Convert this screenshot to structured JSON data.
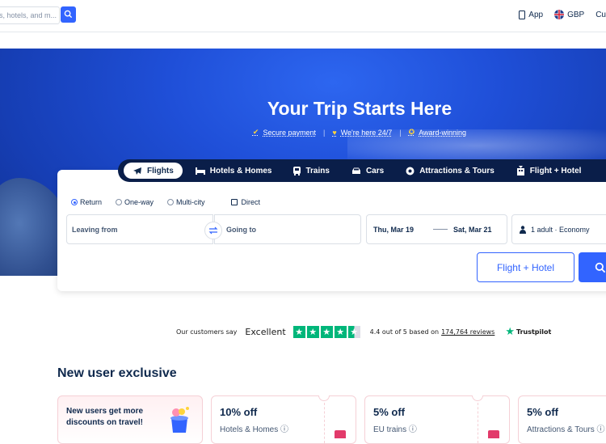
{
  "topbar": {
    "search_placeholder": "s, hotels, and m...",
    "app_label": "App",
    "currency_label": "GBP",
    "more_label": "Cu"
  },
  "hero": {
    "title": "Your Trip Starts Here",
    "perks": [
      "Secure payment",
      "We're here 24/7",
      "Award-winning"
    ]
  },
  "tabs": [
    {
      "label": "Flights",
      "icon": "plane-icon",
      "active": true
    },
    {
      "label": "Hotels & Homes",
      "icon": "bed-icon"
    },
    {
      "label": "Trains",
      "icon": "train-icon"
    },
    {
      "label": "Cars",
      "icon": "car-icon"
    },
    {
      "label": "Attractions & Tours",
      "icon": "attraction-icon"
    },
    {
      "label": "Flight + Hotel",
      "icon": "flight-hotel-icon"
    }
  ],
  "search_form": {
    "trip_types": [
      "Return",
      "One-way",
      "Multi-city"
    ],
    "selected_trip_type": "Return",
    "direct_label": "Direct",
    "leaving_placeholder": "Leaving from",
    "going_placeholder": "Going to",
    "depart_date": "Thu, Mar 19",
    "return_date": "Sat, Mar 21",
    "passengers": "1 adult · Economy",
    "flight_hotel_button": "Flight + Hotel"
  },
  "trustpilot": {
    "prefix": "Our customers say",
    "rating_word": "Excellent",
    "score_text": "4.4 out of 5 based on",
    "reviews_link": "174,764 reviews",
    "brand": "Trustpilot",
    "stars": 4.5
  },
  "promos": {
    "title": "New user exclusive",
    "cards": [
      {
        "heading": "New users get more discounts on travel!"
      },
      {
        "heading": "10% off",
        "sub": "Hotels & Homes ⓘ"
      },
      {
        "heading": "5% off",
        "sub": "EU trains ⓘ"
      },
      {
        "heading": "5% off",
        "sub": "Attractions & Tours ⓘ"
      }
    ]
  },
  "colors": {
    "accent": "#3264ff",
    "tab_bar": "#0a1e49",
    "trustpilot_green": "#00b67a",
    "hero_blue": "#1f4fd8"
  }
}
